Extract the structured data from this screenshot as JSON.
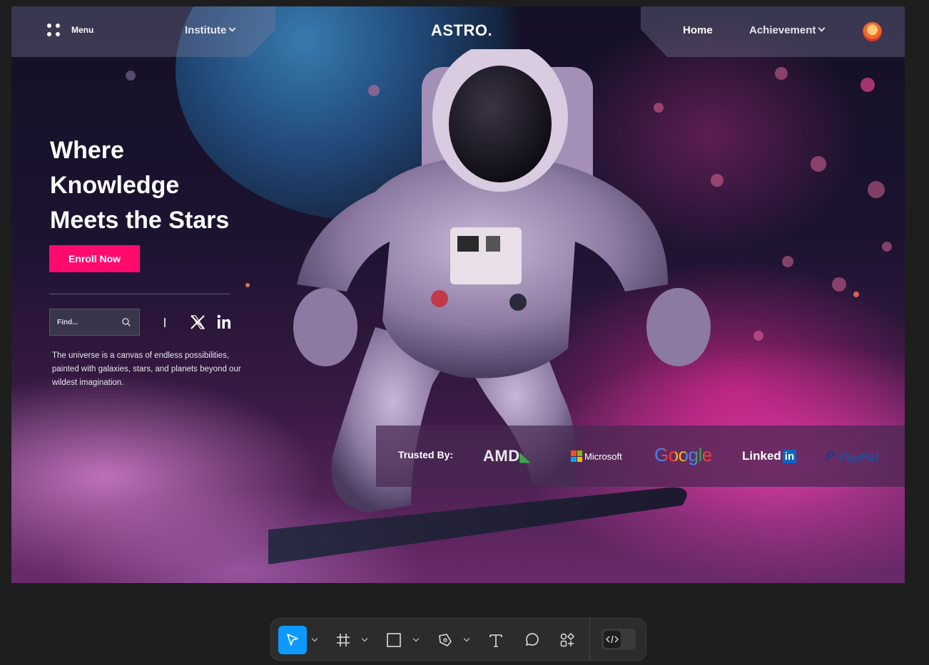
{
  "nav": {
    "menu_label": "Menu",
    "institute_label": "Institute",
    "brand": "ASTRO.",
    "home_label": "Home",
    "achievement_label": "Achievement"
  },
  "hero": {
    "headline_lines": [
      "Where",
      "Knowledge",
      "Meets the Stars"
    ],
    "cta_label": "Enroll Now",
    "search_placeholder": "Find...",
    "description": "The universe is a canvas of endless possibilities, painted with galaxies, stars, and planets beyond our wildest imagination."
  },
  "trusted": {
    "label": "Trusted By:",
    "logos": [
      "AMD",
      "Microsoft",
      "Google",
      "Linked",
      "in",
      "PayPal"
    ]
  },
  "toolbar": {
    "tools": [
      "move-tool",
      "frame-tool",
      "rectangle-tool",
      "pen-tool",
      "text-tool",
      "comment-tool",
      "actions-tool"
    ],
    "dev_mode": "dev-mode-toggle"
  },
  "colors": {
    "accent": "#ff0b6e",
    "toolbar_active": "#0d99ff",
    "canvas_bg": "#1e1e1e"
  }
}
